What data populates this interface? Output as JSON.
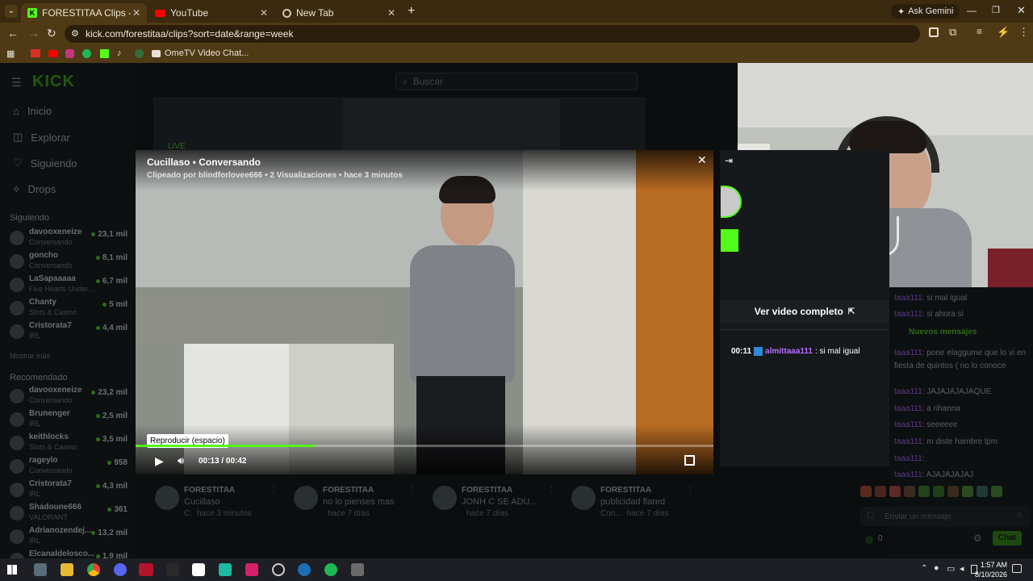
{
  "browser": {
    "tabs": [
      {
        "label": "FORESTITAA Clips - Watch Live",
        "icon": "kick-logo-icon",
        "active": true
      },
      {
        "label": "YouTube",
        "icon": "youtube-icon",
        "active": false
      },
      {
        "label": "New Tab",
        "icon": "chrome-icon",
        "active": false
      }
    ],
    "ask_gemini": "Ask Gemini",
    "url": "kick.com/forestitaa/clips?sort=date&range=week",
    "bookmark_label": "OmeTV Video Chat..."
  },
  "site": {
    "logo": "KICK",
    "search_placeholder": "Buscar",
    "nav": [
      {
        "label": "Inicio",
        "icon": "home-icon"
      },
      {
        "label": "Explorar",
        "icon": "compass-icon"
      },
      {
        "label": "Siguiendo",
        "icon": "heart-icon"
      },
      {
        "label": "Drops",
        "icon": "drop-icon"
      }
    ],
    "following_heading": "Siguiendo",
    "following": [
      {
        "name": "davooxeneize",
        "sub": "Conversando",
        "viewers": "23,1 mil"
      },
      {
        "name": "goncho",
        "sub": "Conversando",
        "viewers": "8,1 mil"
      },
      {
        "name": "LaSapaaaaa",
        "sub": "Five Hearts Under ...",
        "viewers": "6,7 mil"
      },
      {
        "name": "Chanty",
        "sub": "Slots & Casino",
        "viewers": "5 mil"
      },
      {
        "name": "Cristorata7",
        "sub": "IRL",
        "viewers": "4,4 mil"
      }
    ],
    "show_more": "Mostrar más",
    "recommended_heading": "Recomendado",
    "recommended": [
      {
        "name": "davooxeneize",
        "sub": "Conversando",
        "viewers": "23,2 mil"
      },
      {
        "name": "Brunenger",
        "sub": "IRL",
        "viewers": "2,5 mil"
      },
      {
        "name": "keithlocks",
        "sub": "Slots & Casino",
        "viewers": "3,5 mil"
      },
      {
        "name": "rageylo",
        "sub": "Conversando",
        "viewers": "958"
      },
      {
        "name": "Cristorata7",
        "sub": "IRL",
        "viewers": "4,3 mil"
      },
      {
        "name": "Shadoune666",
        "sub": "VALORANT",
        "viewers": "361"
      },
      {
        "name": "Adrianozendej...",
        "sub": "IRL",
        "viewers": "13,2 mil"
      },
      {
        "name": "Elcanaldelosco...",
        "sub": "",
        "viewers": "1,9 mil"
      }
    ],
    "live_label": "LIVE"
  },
  "clip": {
    "title": "Cucillaso • Conversando",
    "meta": "Clipeado por blindforlovee666 • 2 Visualizaciones • hace 3 minutos",
    "tooltip": "Reproducir (espacio)",
    "time": "00:13 / 00:42",
    "progress": 0.31,
    "full_video": "Ver video completo",
    "chat_time": "00:11",
    "chat_user": "almittaaa111",
    "chat_msg": ": si mal igual"
  },
  "live_chat": {
    "messages": [
      {
        "user": "taaa111",
        "msg": ": si mal igual"
      },
      {
        "user": "taaa111",
        "msg": ": si ahora si"
      },
      {
        "user": "taaa111",
        "msg": ": pone elaggume que lo vi en"
      },
      {
        "user": "",
        "msg": "fiesta de quintos ( no lo conoce"
      },
      {
        "user": "taaa111",
        "msg": ": JAJAJAJAJAQUE"
      },
      {
        "user": "taaa111",
        "msg": ": a rihanna"
      },
      {
        "user": "taaa111",
        "msg": ": seeeeee"
      },
      {
        "user": "taaa111",
        "msg": ": m diste hambre lpm"
      },
      {
        "user": "taaa111",
        "msg": ":"
      },
      {
        "user": "taaa111",
        "msg": ": AJAJAJAJAJ"
      }
    ],
    "new_messages": "Nuevos mensajes",
    "input_placeholder": "Enviar un mensaje",
    "count": "0",
    "chat_button": "Chat"
  },
  "clips_row": [
    {
      "channel": "FORESTITAA",
      "title": "Cucillaso",
      "meta": "hace 3 minutos",
      "tag": "C."
    },
    {
      "channel": "FORESTITAA",
      "title": "no lo pienses mas",
      "meta": "hace 7 días",
      "tag": ""
    },
    {
      "channel": "FORESTITAA",
      "title": "JONH C SE ADU...",
      "meta": "hace 7 días",
      "tag": ""
    },
    {
      "channel": "FORESTITAA",
      "title": "publicidad flared",
      "meta": "hace 7 días",
      "tag": "Con..."
    }
  ],
  "taskbar": {
    "time": "1:57 AM",
    "date": "8/10/2026"
  },
  "colors": {
    "kick_green": "#53fc18",
    "chat_purple": "#b36bff",
    "chrome_brown": "#503a16"
  }
}
